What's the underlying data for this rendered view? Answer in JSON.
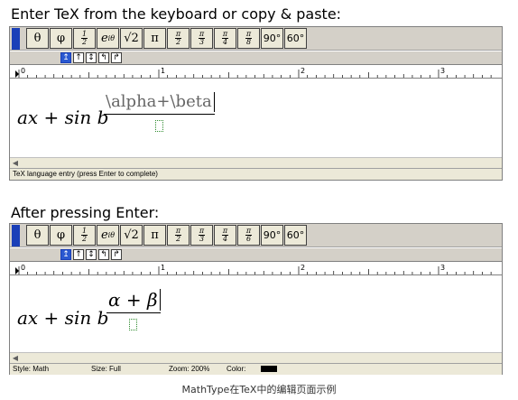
{
  "headings": {
    "first": "Enter TeX from the keyboard or copy & paste:",
    "second": "After pressing Enter:"
  },
  "toolbar": {
    "theta": "θ",
    "phi": "φ",
    "half_num": "1",
    "half_den": "2",
    "exp": "e",
    "exp_sup": "iθ",
    "sqrt": "√2",
    "pi": "π",
    "pi2_num": "π",
    "pi2_den": "2",
    "pi3_num": "π",
    "pi3_den": "3",
    "pi4_num": "π",
    "pi4_den": "4",
    "pi6_num": "π",
    "pi6_den": "6",
    "pi8_den": "8",
    "deg90": "90°",
    "deg60": "60°"
  },
  "nudge": [
    "↥",
    "↑",
    "↕",
    "↰",
    "↱"
  ],
  "ruler": {
    "marks": [
      "0",
      "1",
      "2",
      "3"
    ]
  },
  "editor1": {
    "lhs": "ax + sin b",
    "tex_numerator": "\\alpha+\\beta",
    "status": "TeX language entry (press Enter to complete)"
  },
  "editor2": {
    "lhs": "ax + sin b",
    "numerator": "α + β",
    "status": {
      "style": "Style: Math",
      "size": "Size: Full",
      "zoom": "Zoom: 200%",
      "color": "Color:"
    }
  },
  "colors": {
    "accent_blue": "#1a3fb8",
    "color_swatch": "#000000"
  },
  "caption": "MathType在TeX中的编辑页面示例"
}
